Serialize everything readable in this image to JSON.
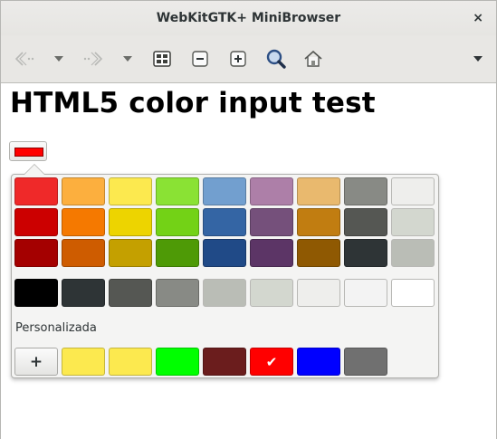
{
  "window": {
    "title": "WebKitGTK+ MiniBrowser",
    "close_glyph": "×"
  },
  "toolbar": {
    "icons": [
      "back-arrow-icon",
      "chevron-down-icon",
      "forward-arrow-icon",
      "chevron-down-icon",
      "inspector-icon",
      "zoom-out-icon",
      "zoom-in-icon",
      "search-icon",
      "home-icon",
      "menu-chevron-down-icon"
    ]
  },
  "page": {
    "heading": "HTML5 color input test",
    "input_value": "#ff0000"
  },
  "palette": {
    "rows": [
      [
        "#ef2929",
        "#fcaf3e",
        "#fce94f",
        "#8ae234",
        "#729fcf",
        "#ad7fa8",
        "#e9b96e",
        "#888a85",
        "#eeeeec"
      ],
      [
        "#cc0000",
        "#f57900",
        "#edd400",
        "#73d216",
        "#3465a4",
        "#75507b",
        "#c17d11",
        "#555753",
        "#d3d7cf"
      ],
      [
        "#a40000",
        "#ce5c00",
        "#c4a000",
        "#4e9a06",
        "#204a87",
        "#5c3566",
        "#8f5902",
        "#2e3436",
        "#babdb6"
      ]
    ],
    "grays": [
      "#000000",
      "#2e3436",
      "#555753",
      "#888a85",
      "#babdb6",
      "#d3d7cf",
      "#eeeeec",
      "#f3f3f3",
      "#ffffff"
    ],
    "custom_label": "Personalizada",
    "add_label": "+",
    "custom": [
      "#fce94f",
      "#fce94f",
      "#00ff00",
      "#6b1d1d",
      "#ff0000",
      "#0000ff",
      "#707070"
    ],
    "selected_index": 4,
    "check_glyph": "✔"
  }
}
